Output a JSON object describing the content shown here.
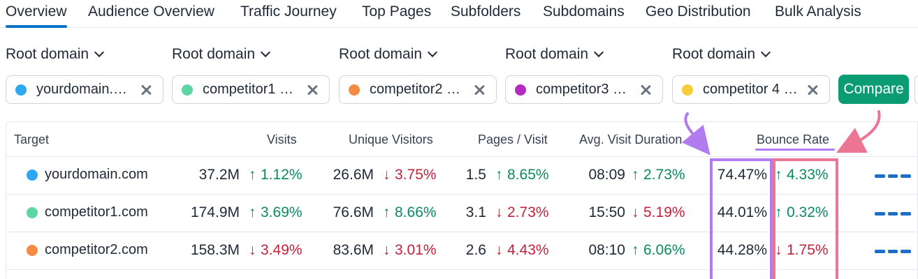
{
  "tabs": [
    "Overview",
    "Audience Overview",
    "Traffic Journey",
    "Top Pages",
    "Subfolders",
    "Subdomains",
    "Geo Distribution",
    "Bulk Analysis"
  ],
  "root_domain_label": "Root domain",
  "chips": [
    {
      "text": "yourdomain.…",
      "color": "#2ea8f0"
    },
    {
      "text": "competitor1 …",
      "color": "#5ed6a4"
    },
    {
      "text": "competitor2 …",
      "color": "#f58b42"
    },
    {
      "text": "competitor3 …",
      "color": "#b42bc2"
    },
    {
      "text": "competitor 4 …",
      "color": "#f7cb3a"
    }
  ],
  "compare_label": "Compare",
  "headers": {
    "target": "Target",
    "visits": "Visits",
    "unique": "Unique Visitors",
    "pages": "Pages / Visit",
    "duration": "Avg. Visit Duration",
    "bounce": "Bounce Rate"
  },
  "rows": [
    {
      "domain": "yourdomain.com",
      "color": "#2ea8f0",
      "visits": "37.2M",
      "visits_delta": "1.12%",
      "visits_dir": "up",
      "unique": "26.6M",
      "unique_delta": "3.75%",
      "unique_dir": "down",
      "pages": "1.5",
      "pages_delta": "8.65%",
      "pages_dir": "up",
      "duration": "08:09",
      "duration_delta": "2.73%",
      "duration_dir": "up",
      "bounce": "74.47%",
      "bounce_delta": "4.33%",
      "bounce_dir": "up"
    },
    {
      "domain": "competitor1.com",
      "color": "#5ed6a4",
      "visits": "174.9M",
      "visits_delta": "3.69%",
      "visits_dir": "up",
      "unique": "76.6M",
      "unique_delta": "8.66%",
      "unique_dir": "up",
      "pages": "3.1",
      "pages_delta": "2.73%",
      "pages_dir": "down",
      "duration": "15:50",
      "duration_delta": "5.19%",
      "duration_dir": "down",
      "bounce": "44.01%",
      "bounce_delta": "0.32%",
      "bounce_dir": "up"
    },
    {
      "domain": "competitor2.com",
      "color": "#f58b42",
      "visits": "158.3M",
      "visits_delta": "3.49%",
      "visits_dir": "down",
      "unique": "83.6M",
      "unique_delta": "3.01%",
      "unique_dir": "down",
      "pages": "2.6",
      "pages_delta": "4.43%",
      "pages_dir": "down",
      "duration": "08:10",
      "duration_delta": "6.06%",
      "duration_dir": "up",
      "bounce": "44.28%",
      "bounce_delta": "1.75%",
      "bounce_dir": "down"
    }
  ],
  "colors": {
    "accent": "#0b72c8",
    "compare": "#0c9c74",
    "up": "#0a8a5f",
    "down": "#c4213a",
    "annotation_purple": "#b07cf0",
    "annotation_pink": "#ec7594"
  },
  "icons": {
    "chevron": "chevron-down-icon",
    "clear": "close-icon",
    "up": "arrow-up-icon",
    "down": "arrow-down-icon",
    "trend": "trend-dashes-icon"
  }
}
